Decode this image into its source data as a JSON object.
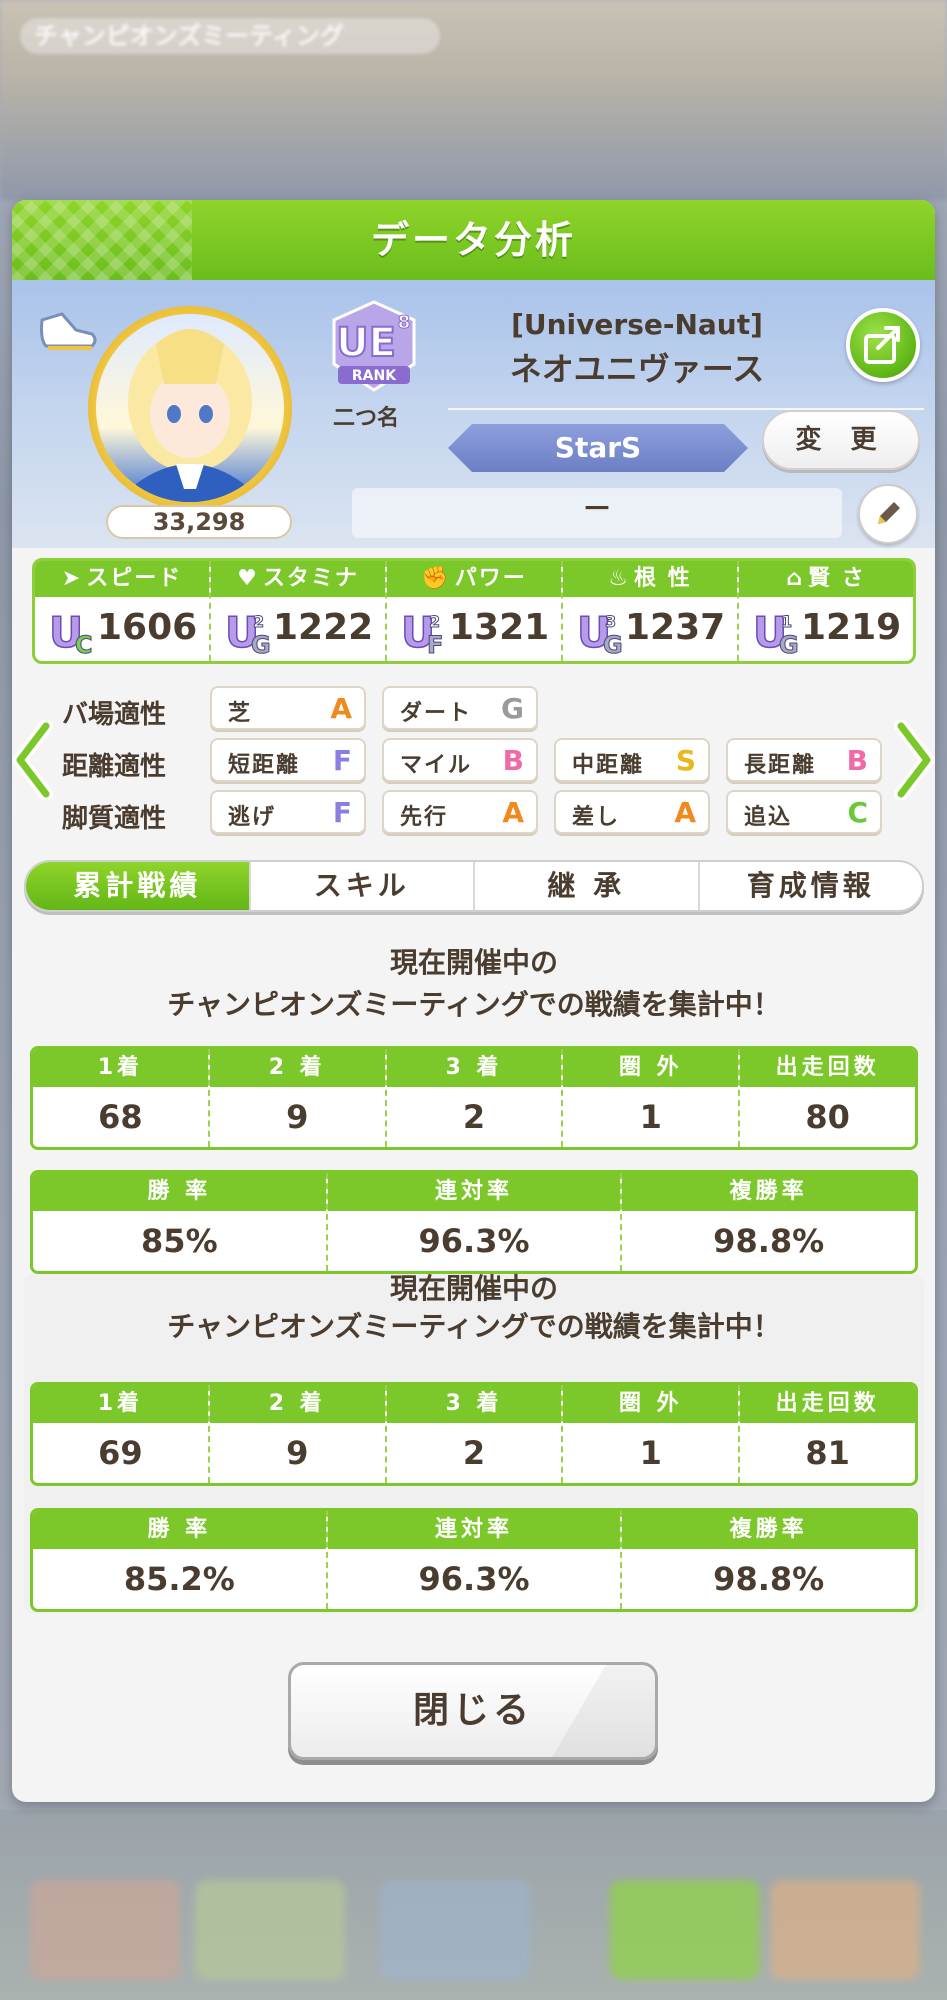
{
  "background": {
    "top_title": "チャンピオンズミーティング"
  },
  "panel": {
    "title": "データ分析"
  },
  "profile": {
    "fans": "33,298",
    "rank": "UE8",
    "rank_caption": "RANK",
    "rank_label": "二つ名",
    "trainer_title": "[Universe-Naut]",
    "trainer_name": "ネオユニヴァース",
    "team": "StarS",
    "change_label": "変 更",
    "comment": "－"
  },
  "stats": [
    {
      "icon": "shoe-icon",
      "label": "スピード",
      "grade": "UC",
      "grade_main": "U",
      "grade_sub": "C",
      "grade_num": "",
      "value": "1606"
    },
    {
      "icon": "heart-icon",
      "label": "スタミナ",
      "grade": "UG2",
      "grade_main": "U",
      "grade_sub": "G",
      "grade_num": "2",
      "value": "1222"
    },
    {
      "icon": "arm-icon",
      "label": "パワー",
      "grade": "UF2",
      "grade_main": "U",
      "grade_sub": "F",
      "grade_num": "2",
      "value": "1321"
    },
    {
      "icon": "fire-icon",
      "label": "根 性",
      "grade": "UG3",
      "grade_main": "U",
      "grade_sub": "G",
      "grade_num": "3",
      "value": "1237"
    },
    {
      "icon": "graduation-cap-icon",
      "label": "賢 さ",
      "grade": "UG1",
      "grade_main": "U",
      "grade_sub": "G",
      "grade_num": "1",
      "value": "1219"
    }
  ],
  "aptitudes": {
    "surface": {
      "label": "バ場適性",
      "items": [
        {
          "name": "芝",
          "grade": "A",
          "color": "#f08a1e"
        },
        {
          "name": "ダート",
          "grade": "G",
          "color": "#9a9a9a"
        }
      ]
    },
    "distance": {
      "label": "距離適性",
      "items": [
        {
          "name": "短距離",
          "grade": "F",
          "color": "#8a7fe0"
        },
        {
          "name": "マイル",
          "grade": "B",
          "color": "#f06aa8"
        },
        {
          "name": "中距離",
          "grade": "S",
          "color": "#e8b91e"
        },
        {
          "name": "長距離",
          "grade": "B",
          "color": "#f06aa8"
        }
      ]
    },
    "style": {
      "label": "脚質適性",
      "items": [
        {
          "name": "逃げ",
          "grade": "F",
          "color": "#8a7fe0"
        },
        {
          "name": "先行",
          "grade": "A",
          "color": "#f08a1e"
        },
        {
          "name": "差し",
          "grade": "A",
          "color": "#f08a1e"
        },
        {
          "name": "追込",
          "grade": "C",
          "color": "#6cc83a"
        }
      ]
    }
  },
  "tabs": [
    {
      "label": "累計戦績",
      "active": true
    },
    {
      "label": "スキル",
      "active": false
    },
    {
      "label": "継 承",
      "active": false
    },
    {
      "label": "育成情報",
      "active": false
    }
  ],
  "records": [
    {
      "heading_line1": "現在開催中の",
      "heading_line2": "チャンピオンズミーティングでの戦績を集計中！",
      "placings": [
        {
          "label": "1着",
          "value": "68"
        },
        {
          "label": "2 着",
          "value": "9"
        },
        {
          "label": "3 着",
          "value": "2"
        },
        {
          "label": "圏 外",
          "value": "1"
        },
        {
          "label": "出走回数",
          "value": "80"
        }
      ],
      "rates": [
        {
          "label": "勝 率",
          "value": "85%"
        },
        {
          "label": "連対率",
          "value": "96.3%"
        },
        {
          "label": "複勝率",
          "value": "98.8%"
        }
      ]
    },
    {
      "heading_line1": "現在開催中の",
      "heading_line2": "チャンピオンズミーティングでの戦績を集計中！",
      "placings": [
        {
          "label": "1着",
          "value": "69"
        },
        {
          "label": "2 着",
          "value": "9"
        },
        {
          "label": "3 着",
          "value": "2"
        },
        {
          "label": "圏 外",
          "value": "1"
        },
        {
          "label": "出走回数",
          "value": "81"
        }
      ],
      "rates": [
        {
          "label": "勝 率",
          "value": "85.2%"
        },
        {
          "label": "連対率",
          "value": "96.3%"
        },
        {
          "label": "複勝率",
          "value": "98.8%"
        }
      ]
    }
  ],
  "close_label": "閉じる",
  "colors": {
    "accent_green": "#7cc72a",
    "text_brown": "#4a3d30"
  }
}
